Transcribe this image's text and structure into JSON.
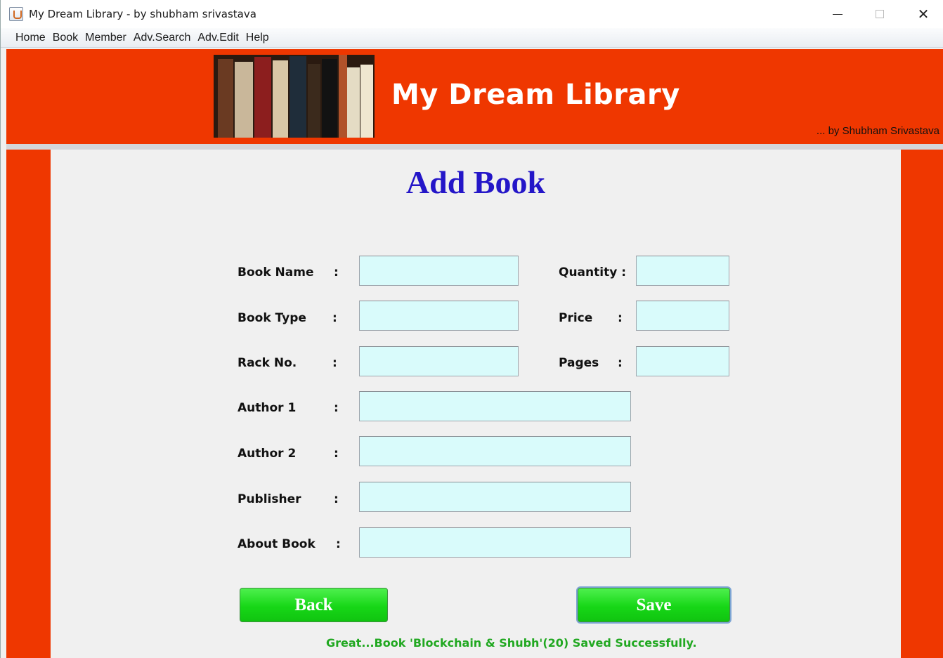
{
  "window": {
    "title": "My Dream Library - by shubham srivastava",
    "controls": {
      "minimize_icon": "minimize-icon",
      "maximize_icon": "maximize-icon",
      "close_icon": "close-icon",
      "close_glyph": "✕"
    }
  },
  "menu": [
    "Home",
    "Book",
    "Member",
    "Adv.Search",
    "Adv.Edit",
    "Help"
  ],
  "banner": {
    "title": "My Dream Library",
    "author": "... by Shubham Srivastava",
    "image": "bookshelf-image",
    "background_color": "#ef3700"
  },
  "form": {
    "title": "Add Book",
    "title_color": "#2416c8",
    "fields": {
      "book_name": {
        "label": "Book Name",
        "colon": ":",
        "value": ""
      },
      "book_type": {
        "label": "Book Type",
        "colon": ":",
        "value": ""
      },
      "rack_no": {
        "label": "Rack No.",
        "colon": ":",
        "value": ""
      },
      "author1": {
        "label": "Author  1",
        "colon": ":",
        "value": ""
      },
      "author2": {
        "label": "Author  2",
        "colon": ":",
        "value": ""
      },
      "publisher": {
        "label": "Publisher",
        "colon": ":",
        "value": ""
      },
      "about_book": {
        "label": "About Book",
        "colon": ":",
        "value": ""
      },
      "quantity": {
        "label": "Quantity :",
        "value": ""
      },
      "price": {
        "label": "Price",
        "colon": ":",
        "value": ""
      },
      "pages": {
        "label": "Pages",
        "colon": ":",
        "value": ""
      }
    },
    "field_background": "#d9fbfb",
    "buttons": {
      "back": "Back",
      "save": "Save"
    },
    "button_color": "#1ed81e",
    "status_message": "Great...Book 'Blockchain & Shubh'(20) Saved Successfully.",
    "status_color": "#21a821"
  }
}
